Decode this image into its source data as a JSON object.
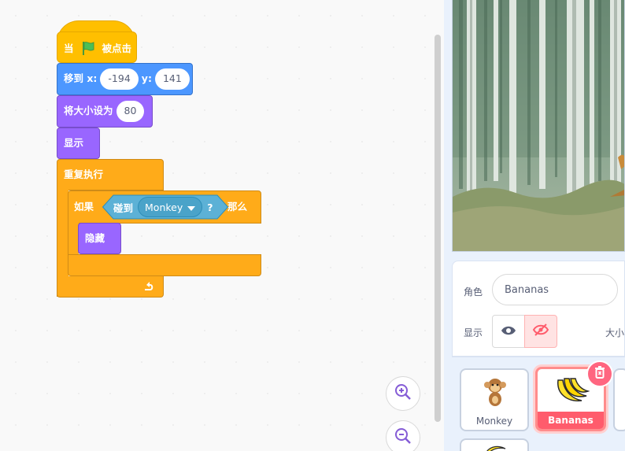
{
  "script": {
    "hat": {
      "label_pre": "当",
      "label_post": "被点击"
    },
    "goto": {
      "label": "移到 x:",
      "x_value": "-194",
      "y_label": "y:",
      "y_value": "141"
    },
    "set_size": {
      "label": "将大小设为",
      "value": "80"
    },
    "show": {
      "label": "显示"
    },
    "forever": {
      "label": "重复执行"
    },
    "if": {
      "label": "如果",
      "then_label": "那么"
    },
    "touching": {
      "label": "碰到",
      "target": "Monkey",
      "question": "?"
    },
    "hide": {
      "label": "隐藏"
    }
  },
  "colors": {
    "events": "#ffbf00",
    "motion": "#4c97ff",
    "looks": "#9966ff",
    "control": "#ffab19",
    "sensing": "#5cb1d6",
    "selected_sprite": "#ff5c6c"
  },
  "zoom": {
    "in_icon": "zoom-in-icon",
    "out_icon": "zoom-out-icon"
  },
  "sprite_info": {
    "sprite_label": "角色",
    "sprite_name": "Bananas",
    "show_label": "显示",
    "size_label": "大小"
  },
  "sprites": [
    {
      "name": "Monkey",
      "selected": false
    },
    {
      "name": "Bananas",
      "selected": true
    }
  ]
}
